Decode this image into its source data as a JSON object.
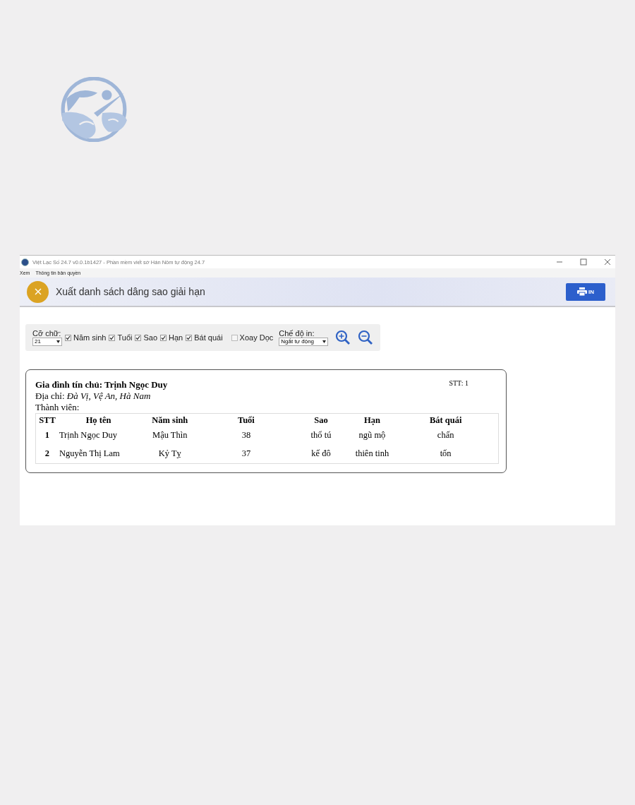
{
  "window": {
    "title": "Việt Lạc Số 24.7 v0.0.1b1427 - Phần mềm viết sớ Hán Nôm tự động 24.7"
  },
  "menu": [
    "Xem",
    "Thông tin bản quyền"
  ],
  "header": {
    "title": "Xuất danh sách dâng sao giải hạn",
    "print_button": "IN"
  },
  "toolbar": {
    "font_size": {
      "label": "Cỡ chữ:",
      "value": "21"
    },
    "options": [
      {
        "label": "Năm sinh",
        "checked": true
      },
      {
        "label": "Tuổi",
        "checked": true
      },
      {
        "label": "Sao",
        "checked": true
      },
      {
        "label": "Hạn",
        "checked": true
      },
      {
        "label": "Bát quái",
        "checked": true
      },
      {
        "label": "Xoay Dọc",
        "checked": false
      }
    ],
    "print_mode": {
      "label": "Chế độ in:",
      "value": "Ngắt tự động"
    }
  },
  "card": {
    "family_label": "Gia đình tín chủ:",
    "family_name": "Trịnh Ngọc Duy",
    "number": "STT: 1",
    "address_label": "Địa chỉ:",
    "address": "Đà Vị, Vệ An, Hà Nam",
    "members_label": "Thành viên:",
    "table": {
      "columns": [
        "STT",
        "Họ tên",
        "Năm sinh",
        "Tuổi",
        "Sao",
        "Hạn",
        "Bát quái"
      ],
      "rows": [
        [
          "1",
          "Trịnh Ngọc Duy",
          "Mậu Thìn",
          "38",
          "thổ tú",
          "ngũ mộ",
          "chấn"
        ],
        [
          "2",
          "Nguyễn Thị Lam",
          "Kỷ Tỵ",
          "37",
          "kế đô",
          "thiên tinh",
          "tốn"
        ]
      ]
    }
  }
}
